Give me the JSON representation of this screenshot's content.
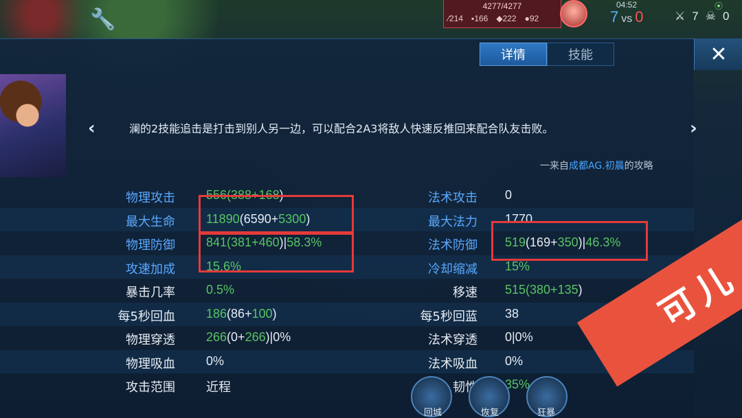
{
  "hud": {
    "hp": "4277/4277",
    "stat1": "214",
    "stat2": "166",
    "stat3": "222",
    "stat4": "92",
    "time": "04:52",
    "score_blue": "7",
    "score_vs": "vs",
    "score_red": "0",
    "kills": "7",
    "deaths": "0"
  },
  "tabs": {
    "details": "详情",
    "skills": "技能"
  },
  "tip": {
    "text": "澜的2技能追击是打击到别人另一边，可以配合2A3将敌人快速反推回来配合队友击败。",
    "source_prefix": "一来自",
    "source_name": "成都AG.初晨",
    "source_suffix": "的攻略"
  },
  "stats": {
    "rows": [
      {
        "l_label": "物理攻击",
        "l_base": "556(388+",
        "l_bonus": "168",
        "l_tail": ")",
        "l_color": "blue",
        "r_label": "法术攻击",
        "r_value": "0",
        "r_color": "blue"
      },
      {
        "l_label": "最大生命",
        "l_total": "11890",
        "l_base": "(6590+",
        "l_bonus": "5300",
        "l_tail": ")",
        "l_color": "blue",
        "r_label": "最大法力",
        "r_value": "1770",
        "r_color": "blue"
      },
      {
        "l_label": "物理防御",
        "l_base": "841(381+",
        "l_bonus": "460",
        "l_tail": ")|",
        "l_pct": "58.3%",
        "l_color": "blue",
        "r_label": "法术防御",
        "r_total": "519",
        "r_base": "(169+",
        "r_bonus": "350",
        "r_tail": ")|",
        "r_pct": "46.3%",
        "r_color": "blue"
      },
      {
        "l_label": "攻速加成",
        "l_value": "15.6%",
        "l_color": "blue",
        "r_label": "冷却缩减",
        "r_value": "15%",
        "r_color": "blue"
      },
      {
        "l_label": "暴击几率",
        "l_value": "0.5%",
        "r_label": "移速",
        "r_base": "515(380+",
        "r_bonus": "135",
        "r_tail": ")"
      },
      {
        "l_label": "每5秒回血",
        "l_total": "186",
        "l_base": "(86+",
        "l_bonus": "100",
        "l_tail": ")",
        "r_label": "每5秒回蓝",
        "r_value": "38"
      },
      {
        "l_label": "物理穿透",
        "l_total": "266",
        "l_base": "(0+",
        "l_bonus": "266",
        "l_tail": ")|0%",
        "r_label": "法术穿透",
        "r_value": "0|0%"
      },
      {
        "l_label": "物理吸血",
        "l_value": "0%",
        "r_label": "法术吸血",
        "r_value": "0%"
      },
      {
        "l_label": "攻击范围",
        "l_value": "近程",
        "r_label": "韧性",
        "r_value": "35%"
      }
    ]
  },
  "skills": {
    "recall": "回城",
    "restore": "恢复",
    "smite": "狂暴"
  },
  "watermark": "可儿",
  "colors": {
    "accent_blue": "#5aa8ff",
    "bonus_green": "#58c464",
    "highlight_red": "#e53a3a"
  }
}
